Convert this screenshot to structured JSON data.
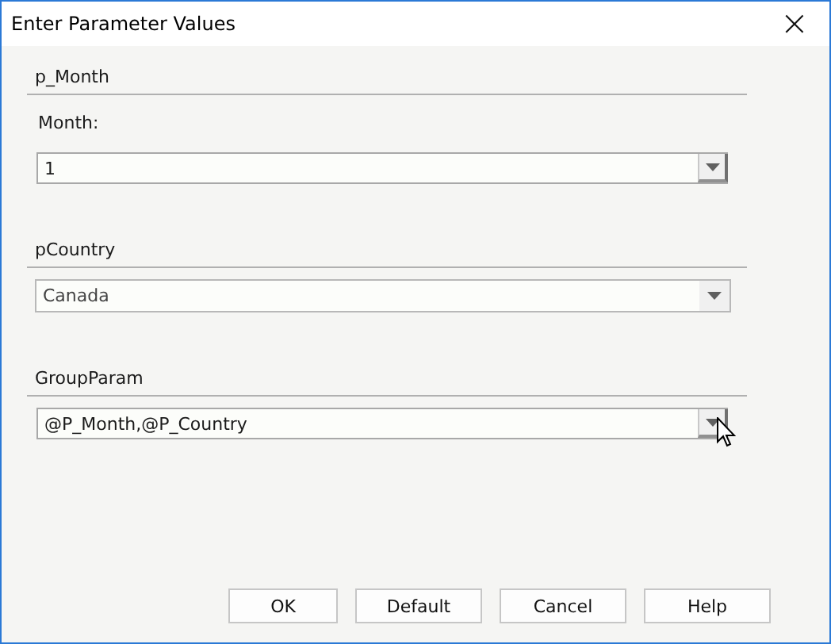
{
  "window": {
    "title": "Enter Parameter Values",
    "close": "×"
  },
  "groups": [
    {
      "title": "p_Month",
      "label": "Month:",
      "combo": {
        "kind": "editable",
        "value": "1"
      }
    },
    {
      "title": "pCountry",
      "combo": {
        "kind": "list",
        "value": "Canada"
      }
    },
    {
      "title": "GroupParam",
      "combo": {
        "kind": "editable",
        "value": "@P_Month,@P_Country"
      }
    }
  ],
  "buttons": [
    "OK",
    "Default",
    "Cancel",
    "Help"
  ]
}
